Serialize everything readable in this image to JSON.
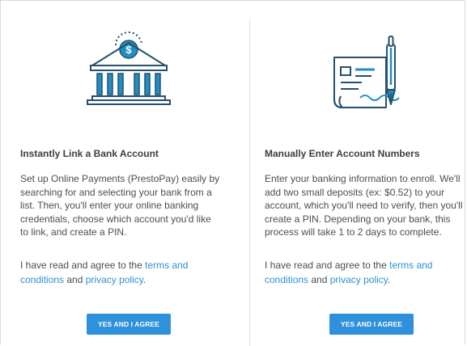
{
  "colors": {
    "accent": "#2f91db",
    "link": "#2f8fd6",
    "icon_primary": "#1f8fc4",
    "icon_dark": "#25506b"
  },
  "left": {
    "icon": "bank-icon",
    "title": "Instantly Link a Bank Account",
    "description": "Set up Online Payments (PrestoPay) easily by searching for and selecting your bank from a list. Then, you'll enter your online banking credentials, choose which account you'd like to link, and create a PIN.",
    "agree_prefix": "I have read and agree to the ",
    "terms_link": "terms and conditions",
    "agree_middle": " and ",
    "privacy_link": "privacy policy",
    "agree_suffix": ".",
    "button_label": "YES AND I AGREE"
  },
  "right": {
    "icon": "check-and-pen-icon",
    "title": "Manually Enter Account Numbers",
    "description": "Enter your banking information to enroll. We'll add two small deposits (ex: $0.52) to your account, which you'll need to verify, then you'll create a PIN. Depending on your bank, this process will take 1 to 2 days to complete.",
    "agree_prefix": "I have read and agree to the ",
    "terms_link": "terms and conditions",
    "agree_middle": " and ",
    "privacy_link": "privacy policy",
    "agree_suffix": ".",
    "button_label": "YES AND I AGREE"
  }
}
